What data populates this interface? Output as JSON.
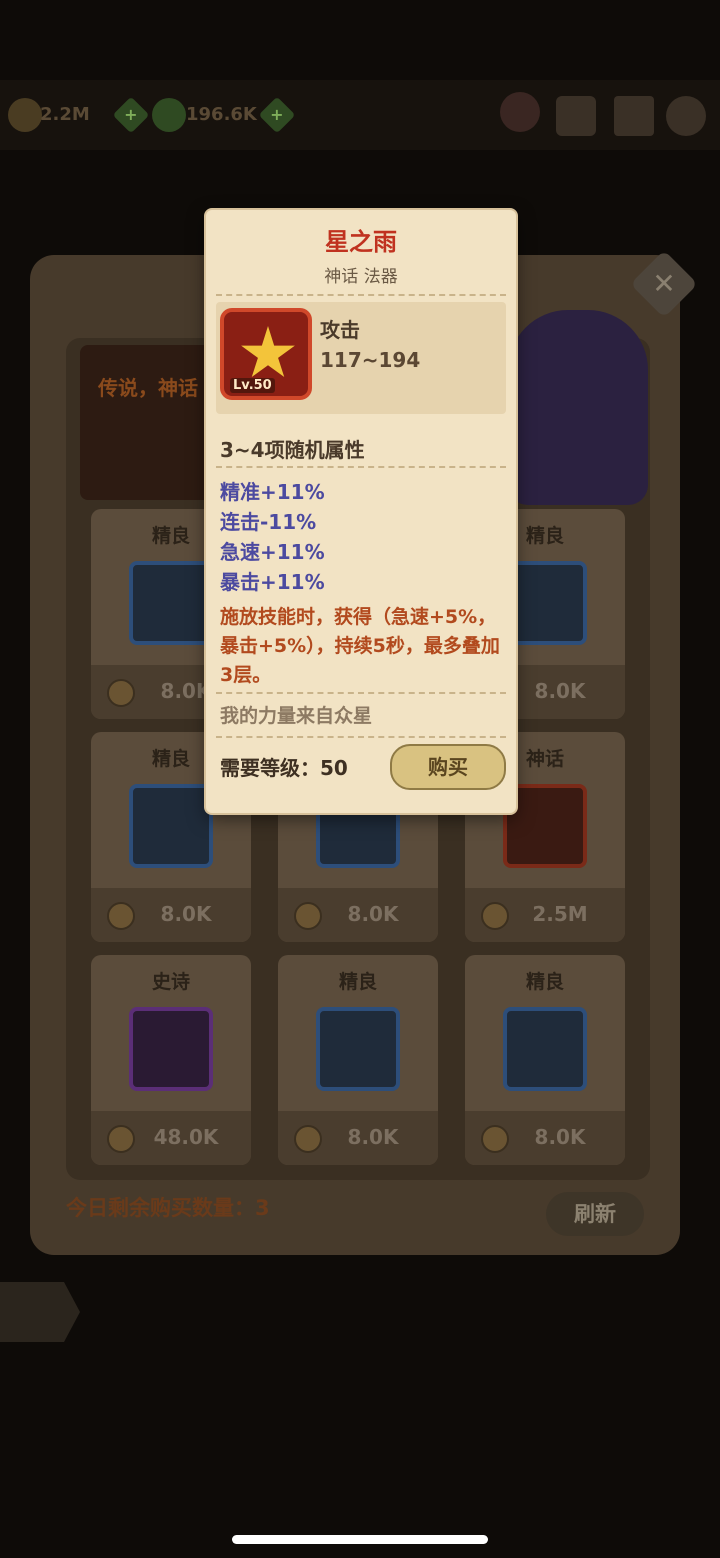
{
  "topbar": {
    "gold": "2.2M",
    "gems": "196.6K"
  },
  "shop": {
    "banner_text": "传说，神话",
    "remaining_label": "今日剩余购买数量：3",
    "refresh_label": "刷新",
    "close_label": "✕",
    "cards": [
      {
        "quality": "精良",
        "price": "8.0K"
      },
      {
        "quality": "精良",
        "price": "8.0K"
      },
      {
        "quality": "精良",
        "price": "8.0K"
      },
      {
        "quality": "精良",
        "price": "8.0K"
      },
      {
        "quality": "神话",
        "price": "2.5M"
      },
      {
        "quality": "史诗",
        "price": "48.0K"
      },
      {
        "quality": "精良",
        "price": "8.0K"
      },
      {
        "quality": "精良",
        "price": "8.0K"
      }
    ],
    "card_extra_prices": [
      "8.0K"
    ]
  },
  "tooltip": {
    "title": "星之雨",
    "subtitle": "神话 法器",
    "level_badge": "Lv.50",
    "attack_label": "攻击",
    "attack_value": "117~194",
    "random_attr_title": "3~4项随机属性",
    "stats": [
      "精准+11%",
      "连击-11%",
      "急速+11%",
      "暴击+11%"
    ],
    "skill_desc": "施放技能时，获得（急速+5%，暴击+5%），持续5秒，最多叠加3层。",
    "flavor": "我的力量来自众星",
    "requirement": "需要等级：50",
    "buy_label": "购买"
  }
}
